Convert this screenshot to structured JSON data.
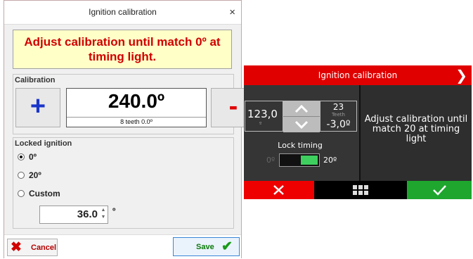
{
  "dialog": {
    "title": "Ignition calibration",
    "close_label": "×",
    "banner": "Adjust calibration until match 0º at timing light.",
    "calibration": {
      "group_label": "Calibration",
      "plus_label": "+",
      "minus_label": "-",
      "value": "240.0º",
      "sub_value": "8 teeth 0.0º"
    },
    "locked_ignition": {
      "group_label": "Locked ignition",
      "options": [
        {
          "label": "0º",
          "checked": true
        },
        {
          "label": "20º",
          "checked": false
        },
        {
          "label": "Custom",
          "checked": false
        }
      ],
      "custom_value": "36.0",
      "custom_unit": "º"
    },
    "footer": {
      "cancel_label": "Cancel",
      "save_label": "Save"
    }
  },
  "screen": {
    "title": "Ignition calibration",
    "next_arrow": "❯",
    "value": "123,0",
    "value_unit": "º",
    "teeth_count": "23",
    "teeth_label": "Teeth",
    "teeth_offset": "-3,0º",
    "lock_timing_label": "Lock timing",
    "toggle_low_label": "0º",
    "toggle_high_label": "20º",
    "toggle_state": "on",
    "message": "Adjust calibration until match 20 at timing light",
    "colors": {
      "header": "#e00000",
      "cancel": "#ee0000",
      "ok": "#1ea62e",
      "toggle_on": "#3ecf5f"
    },
    "footer_icons": [
      "close-icon",
      "grid-icon",
      "check-icon"
    ]
  }
}
